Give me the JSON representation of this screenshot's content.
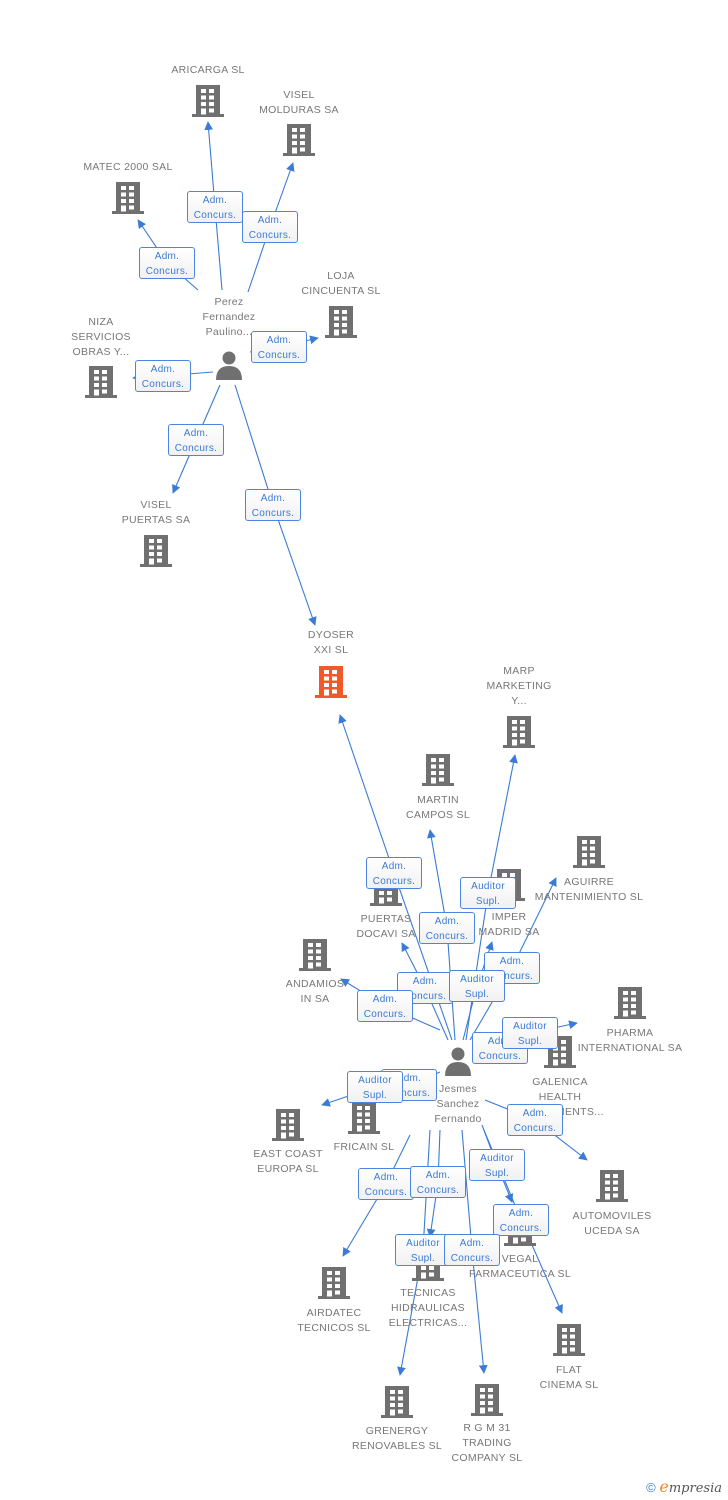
{
  "colors": {
    "edge": "#3a7bd5",
    "node": "#707070",
    "focus_node": "#f05a28",
    "label": "#777777"
  },
  "nodes": [
    {
      "id": "aricarga",
      "type": "company",
      "lines": [
        "ARICARGA SL"
      ]
    },
    {
      "id": "visel_molduras",
      "type": "company",
      "lines": [
        "VISEL",
        "MOLDURAS SA"
      ]
    },
    {
      "id": "matec",
      "type": "company",
      "lines": [
        "MATEC 2000 SAL"
      ]
    },
    {
      "id": "loja",
      "type": "company",
      "lines": [
        "LOJA",
        "CINCUENTA SL"
      ]
    },
    {
      "id": "niza",
      "type": "company",
      "lines": [
        "NIZA",
        "SERVICIOS",
        "OBRAS Y..."
      ]
    },
    {
      "id": "perez",
      "type": "person",
      "lines": [
        "Perez",
        "Fernandez",
        "Paulino..."
      ]
    },
    {
      "id": "visel_puertas",
      "type": "company",
      "lines": [
        "VISEL",
        "PUERTAS SA"
      ]
    },
    {
      "id": "dyoser",
      "type": "company",
      "focus": true,
      "lines": [
        "DYOSER",
        "XXI SL"
      ]
    },
    {
      "id": "marp",
      "type": "company",
      "lines": [
        "MARP",
        "MARKETING",
        "Y..."
      ]
    },
    {
      "id": "martin",
      "type": "company",
      "lines": [
        "MARTIN",
        "CAMPOS SL"
      ]
    },
    {
      "id": "docavi",
      "type": "company",
      "lines": [
        "PUERTAS",
        "DOCAVI SA"
      ]
    },
    {
      "id": "imper",
      "type": "company",
      "lines": [
        "IMPER",
        "MADRID SA"
      ]
    },
    {
      "id": "aguirre",
      "type": "company",
      "lines": [
        "AGUIRRE",
        "MANTENIMIENTO SL"
      ]
    },
    {
      "id": "andamios",
      "type": "company",
      "lines": [
        "ANDAMIOS",
        "IN SA"
      ]
    },
    {
      "id": "pharma",
      "type": "company",
      "lines": [
        "PHARMA",
        "INTERNATIONAL SA"
      ]
    },
    {
      "id": "galenica",
      "type": "company",
      "lines": [
        "GALENICA",
        "HEALTH",
        "INVESTMENTS..."
      ]
    },
    {
      "id": "jesmes",
      "type": "person",
      "lines": [
        "Jesmes",
        "Sanchez",
        "Fernando"
      ]
    },
    {
      "id": "fricain",
      "type": "company",
      "lines": [
        "FRICAIN SL"
      ]
    },
    {
      "id": "eastcoast",
      "type": "company",
      "lines": [
        "EAST COAST",
        "EUROPA SL"
      ]
    },
    {
      "id": "automoviles",
      "type": "company",
      "lines": [
        "AUTOMOVILES",
        "UCEDA SA"
      ]
    },
    {
      "id": "vegal",
      "type": "company",
      "lines": [
        "VEGAL",
        "FARMACEUTICA SL"
      ]
    },
    {
      "id": "airdatec",
      "type": "company",
      "lines": [
        "AIRDATEC",
        "TECNICOS SL"
      ]
    },
    {
      "id": "tecnicas",
      "type": "company",
      "lines": [
        "TECNICAS",
        "HIDRAULICAS",
        "ELECTRICAS..."
      ]
    },
    {
      "id": "flat",
      "type": "company",
      "lines": [
        "FLAT",
        "CINEMA SL"
      ]
    },
    {
      "id": "grenergy",
      "type": "company",
      "lines": [
        "GRENERGY",
        "RENOVABLES SL"
      ]
    },
    {
      "id": "rgm",
      "type": "company",
      "lines": [
        "R G M 31",
        "TRADING",
        "COMPANY SL"
      ]
    }
  ],
  "roles": {
    "adm": [
      "Adm.",
      "Concurs."
    ],
    "aud": [
      "Auditor",
      "Supl."
    ]
  },
  "edges": [
    {
      "from": "perez",
      "to": "aricarga",
      "role": "adm"
    },
    {
      "from": "perez",
      "to": "visel_molduras",
      "role": "adm"
    },
    {
      "from": "perez",
      "to": "matec",
      "role": "adm"
    },
    {
      "from": "perez",
      "to": "loja",
      "role": "adm"
    },
    {
      "from": "perez",
      "to": "niza",
      "role": "adm"
    },
    {
      "from": "perez",
      "to": "visel_puertas",
      "role": "adm"
    },
    {
      "from": "perez",
      "to": "dyoser",
      "role": "adm"
    },
    {
      "from": "jesmes",
      "to": "dyoser",
      "role": "adm"
    },
    {
      "from": "jesmes",
      "to": "marp",
      "role": "aud"
    },
    {
      "from": "jesmes",
      "to": "martin",
      "role": "adm"
    },
    {
      "from": "jesmes",
      "to": "aguirre",
      "role": "adm"
    },
    {
      "from": "jesmes",
      "to": "docavi",
      "role": "adm"
    },
    {
      "from": "jesmes",
      "to": "imper",
      "role": "aud"
    },
    {
      "from": "jesmes",
      "to": "andamios",
      "role": "adm"
    },
    {
      "from": "jesmes",
      "to": "galenica",
      "role": "adm"
    },
    {
      "from": "jesmes",
      "to": "pharma",
      "role": "aud"
    },
    {
      "from": "jesmes",
      "to": "fricain",
      "role": "adm"
    },
    {
      "from": "jesmes",
      "to": "eastcoast",
      "role": "aud"
    },
    {
      "from": "jesmes",
      "to": "automoviles",
      "role": "adm"
    },
    {
      "from": "jesmes",
      "to": "vegal",
      "role": "aud"
    },
    {
      "from": "jesmes",
      "to": "airdatec",
      "role": "adm"
    },
    {
      "from": "jesmes",
      "to": "tecnicas",
      "role": "adm"
    },
    {
      "from": "jesmes",
      "to": "flat",
      "role": "adm"
    },
    {
      "from": "jesmes",
      "to": "grenergy",
      "role": "aud"
    },
    {
      "from": "jesmes",
      "to": "rgm",
      "role": "adm"
    }
  ],
  "footer": {
    "copyright": "©",
    "brand_initial": "e",
    "brand_rest": "mpresia"
  }
}
